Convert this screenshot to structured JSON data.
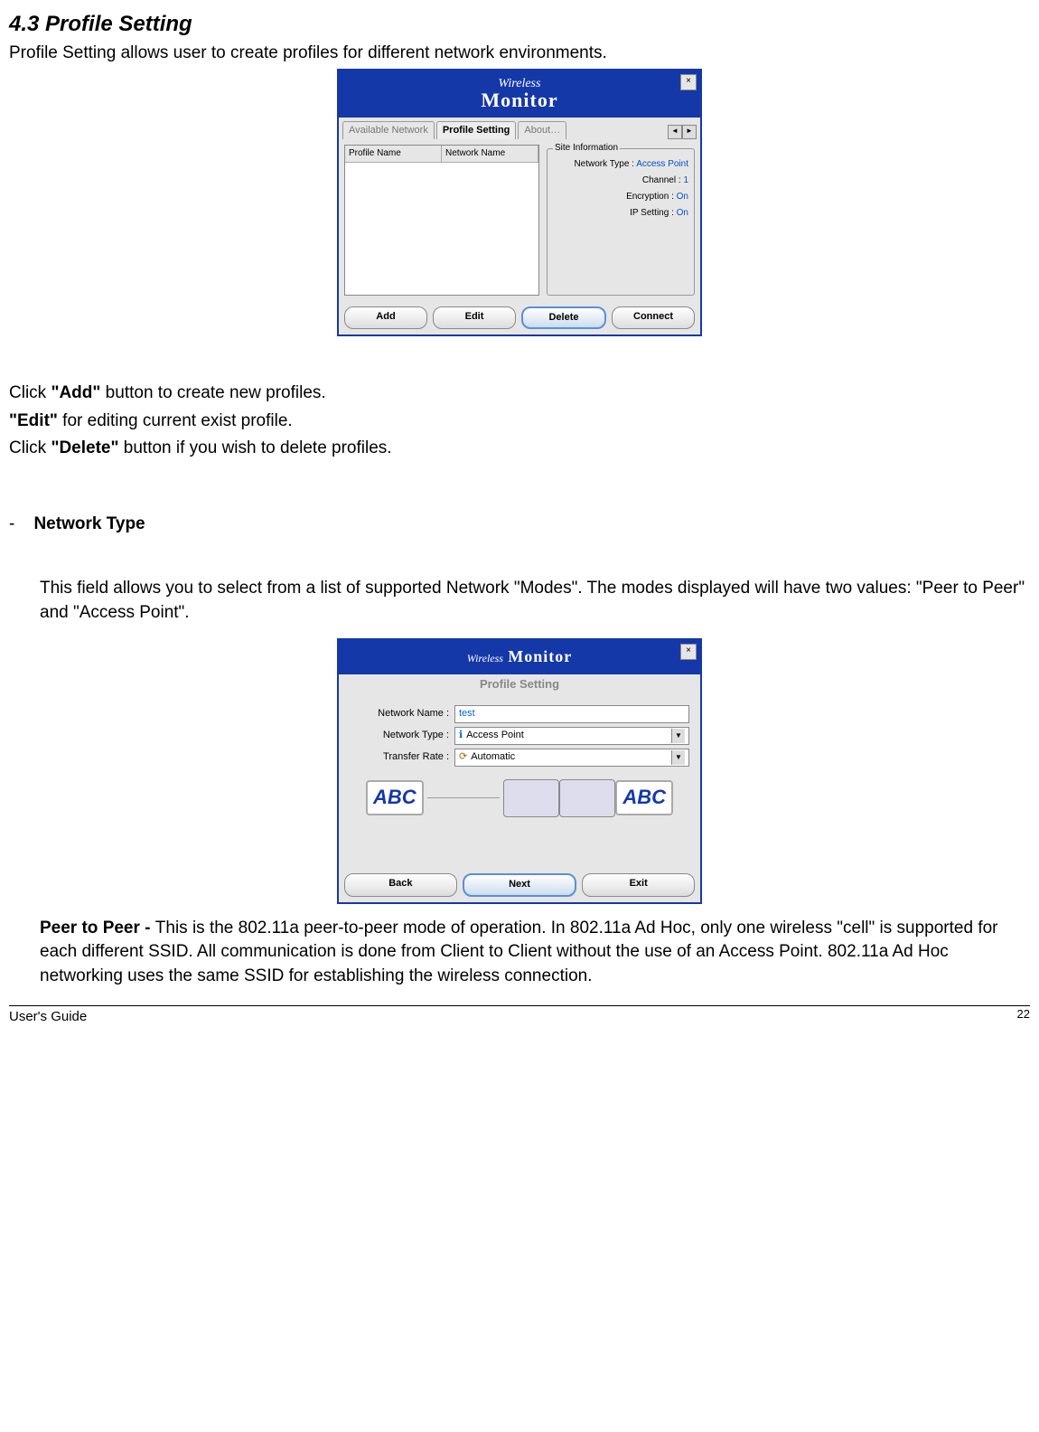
{
  "section_heading": "4.3 Profile Setting",
  "intro_text": "Profile Setting allows user to create profiles for different network environments.",
  "window1": {
    "logo_line1": "Wireless",
    "logo_line2": "Monitor",
    "close_x": "×",
    "tabs": {
      "t1": "Available Network",
      "t2": "Profile Setting",
      "t3": "About…",
      "arrow_left": "◄",
      "arrow_right": "►"
    },
    "list_headers": {
      "h1": "Profile Name",
      "h2": "Network Name"
    },
    "site_info_title": "Site Information",
    "site_rows": {
      "r1_label": "Network Type :",
      "r1_val": "Access Point",
      "r2_label": "Channel :",
      "r2_val": "1",
      "r3_label": "Encryption :",
      "r3_val": "On",
      "r4_label": "IP Setting :",
      "r4_val": "On"
    },
    "buttons": {
      "add": "Add",
      "edit": "Edit",
      "delete": "Delete",
      "connect": "Connect"
    }
  },
  "instructions": {
    "line1_a": "Click ",
    "line1_b": "\"Add\"",
    "line1_c": " button to create new profiles.",
    "line2_a": "\"Edit\"",
    "line2_b": " for editing current exist profile.",
    "line3_a": "Click ",
    "line3_b": "\"Delete\"",
    "line3_c": " button if you wish to delete profiles."
  },
  "dash": "-",
  "network_type_label": "Network Type",
  "nt_para": "This field allows you to select from a list of supported Network \"Modes\".  The modes displayed will have two values:  \"Peer to Peer\" and \"Access Point\".",
  "window2": {
    "logo_line1": "Wireless",
    "logo_line2": "Monitor",
    "close_x": "×",
    "subtitle": "Profile Setting",
    "rows": {
      "r1_label": "Network Name :",
      "r1_val": "test",
      "r2_label": "Network Type :",
      "r2_val": "Access Point",
      "r2_icon": "ℹ",
      "r3_label": "Transfer Rate :",
      "r3_val": "Automatic",
      "r3_icon": "⟳"
    },
    "abc": "ABC",
    "buttons": {
      "back": "Back",
      "next": "Next",
      "exit": "Exit"
    }
  },
  "p2p_label": "Peer to Peer   - ",
  "p2p_text": "This is the 802.11a peer-to-peer mode of operation.  In 802.11a Ad Hoc, only one wireless \"cell\" is supported for each different SSID.  All communication is done from Client to Client without the use of an Access Point. 802.11a  Ad Hoc networking uses the same SSID for establishing the wireless connection.",
  "footer_doc": "User's Guide",
  "footer_page": "22"
}
